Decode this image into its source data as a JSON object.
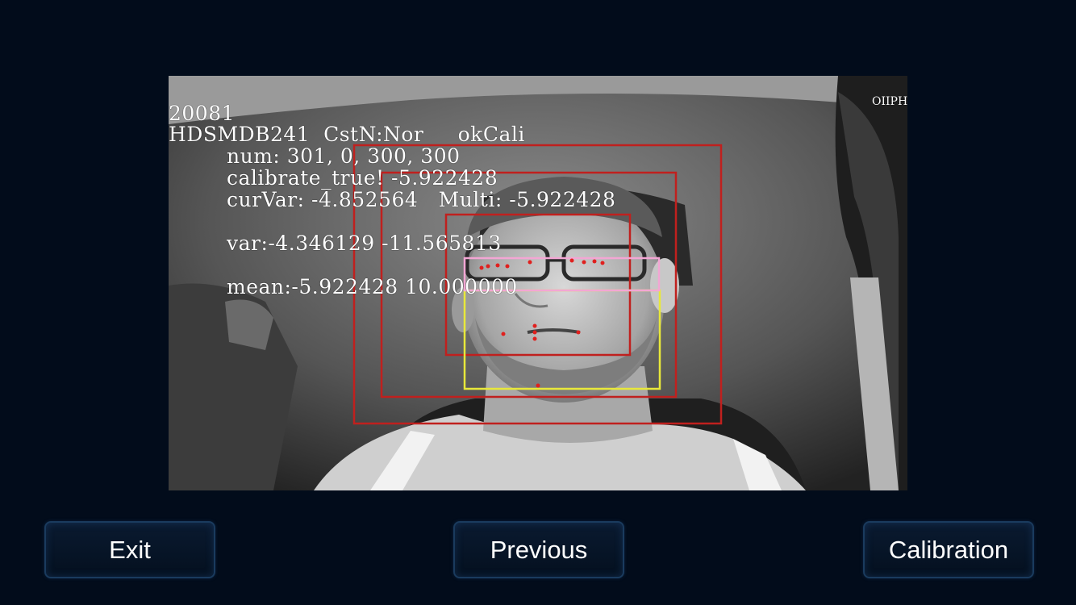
{
  "camera": {
    "osd": {
      "frame_id": "20081",
      "status_line": "HDSMDB241  CstN:Nor     okCali",
      "num_line": "num: 301, 0, 300, 300",
      "calibrate_line": "calibrate_true! -5.922428",
      "curvar_line": "curVar: -4.852564   Multi: -5.922428",
      "var_line": "var:-4.346129 -11.565813",
      "mean_line": "mean:-5.922428 10.000000",
      "corner_tag": "OIIPH"
    }
  },
  "buttons": {
    "exit_label": "Exit",
    "previous_label": "Previous",
    "calibration_label": "Calibration"
  },
  "colors": {
    "background": "#020c1b",
    "box_red": "#c0201e",
    "box_pink": "#f3a6d4",
    "box_yellow": "#e8e83a"
  }
}
